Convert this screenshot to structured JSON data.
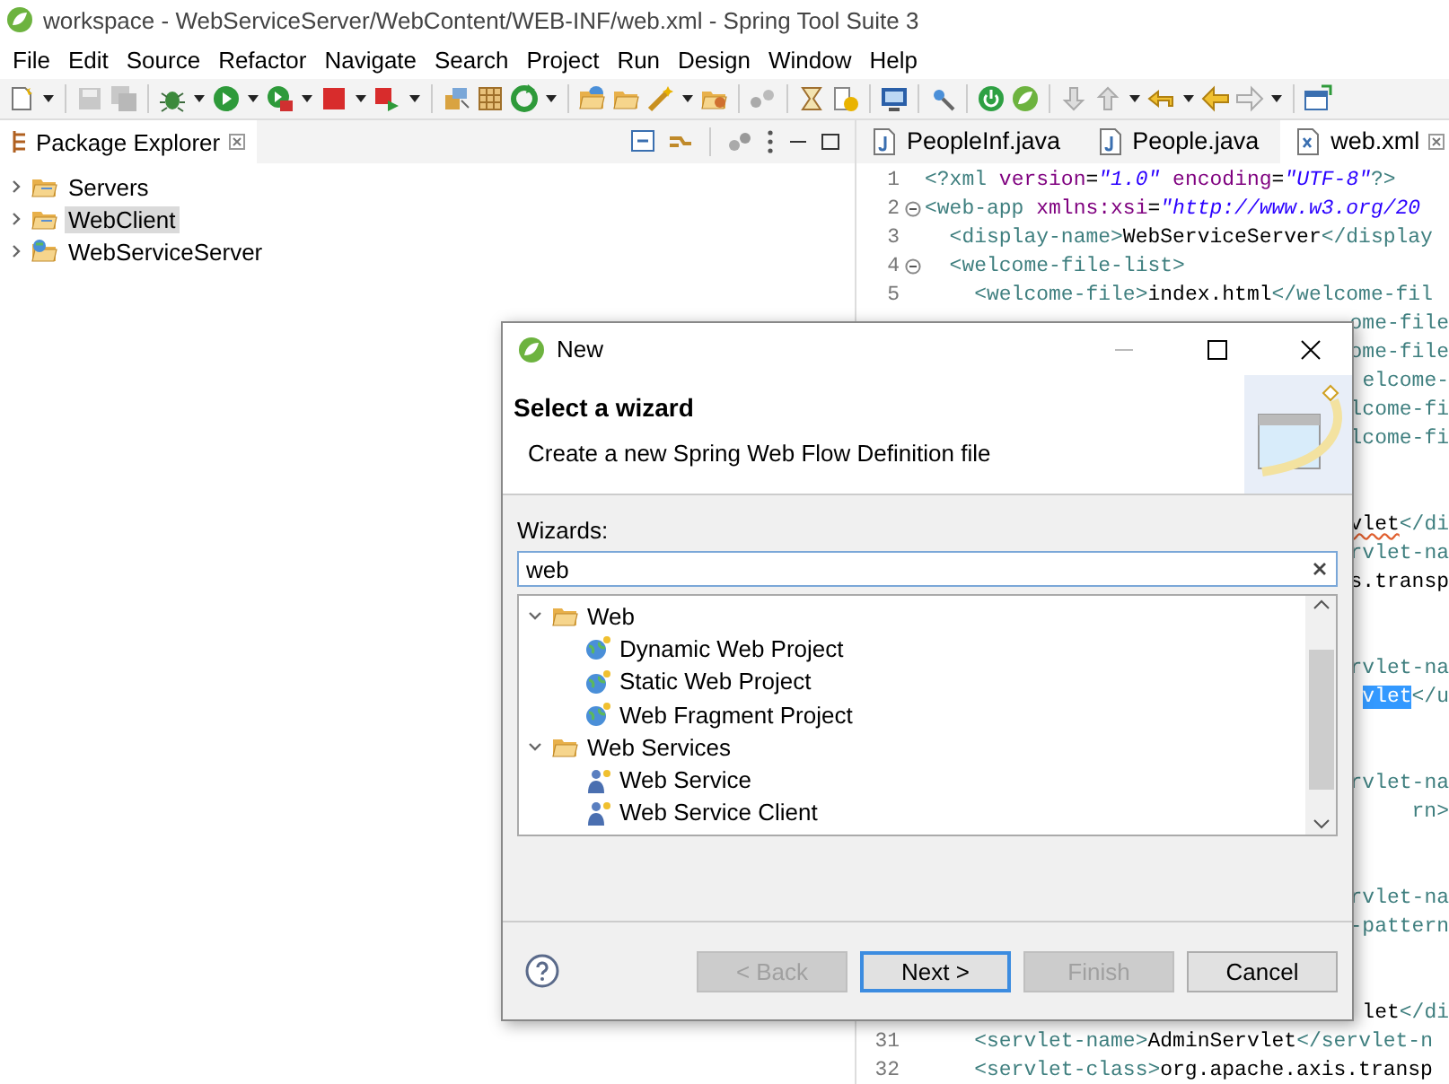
{
  "window": {
    "title": "workspace - WebServiceServer/WebContent/WEB-INF/web.xml - Spring Tool Suite 3"
  },
  "menu": [
    "File",
    "Edit",
    "Source",
    "Refactor",
    "Navigate",
    "Search",
    "Project",
    "Run",
    "Design",
    "Window",
    "Help"
  ],
  "package_explorer": {
    "title": "Package Explorer",
    "items": [
      {
        "label": "Servers",
        "kind": "folder",
        "expanded": false,
        "selected": false
      },
      {
        "label": "WebClient",
        "kind": "folder",
        "expanded": false,
        "selected": true
      },
      {
        "label": "WebServiceServer",
        "kind": "project",
        "expanded": false,
        "selected": false
      }
    ]
  },
  "editor": {
    "tabs": [
      {
        "label": "PeopleInf.java",
        "kind": "java",
        "selected": false
      },
      {
        "label": "People.java",
        "kind": "java",
        "selected": false
      },
      {
        "label": "web.xml",
        "kind": "xml",
        "selected": true
      }
    ],
    "lines": [
      {
        "number": "1",
        "fold": false,
        "behind_dialog": false,
        "segments": [
          {
            "kind": "tag",
            "text": "<?xml"
          },
          {
            "kind": "attr",
            "text": " version"
          },
          {
            "kind": "text",
            "text": "="
          },
          {
            "kind": "value",
            "text": "\"1.0\""
          },
          {
            "kind": "attr",
            "text": " encoding"
          },
          {
            "kind": "text",
            "text": "="
          },
          {
            "kind": "value",
            "text": "\"UTF-8\""
          },
          {
            "kind": "tag",
            "text": "?>"
          }
        ]
      },
      {
        "number": "2",
        "fold": true,
        "behind_dialog": false,
        "segments": [
          {
            "kind": "tag",
            "text": "<web-app"
          },
          {
            "kind": "attr",
            "text": " xmlns:xsi"
          },
          {
            "kind": "text",
            "text": "="
          },
          {
            "kind": "value",
            "text": "\"http://www.w3.org/20"
          }
        ]
      },
      {
        "number": "3",
        "fold": false,
        "behind_dialog": false,
        "segments": [
          {
            "kind": "tag",
            "text": "  <display-name>"
          },
          {
            "kind": "text",
            "text": "WebServiceServer"
          },
          {
            "kind": "tag",
            "text": "</display"
          }
        ]
      },
      {
        "number": "4",
        "fold": true,
        "behind_dialog": false,
        "segments": [
          {
            "kind": "tag",
            "text": "  <welcome-file-list>"
          }
        ]
      },
      {
        "number": "5",
        "fold": false,
        "behind_dialog": false,
        "segments": [
          {
            "kind": "tag",
            "text": "    <welcome-file>"
          },
          {
            "kind": "text",
            "text": "index.html"
          },
          {
            "kind": "tag",
            "text": "</welcome-fil"
          }
        ]
      },
      {
        "behind_dialog": true,
        "segments": [
          {
            "kind": "tag",
            "text": "ome-file"
          }
        ]
      },
      {
        "behind_dialog": true,
        "segments": [
          {
            "kind": "tag",
            "text": "ome-file"
          }
        ]
      },
      {
        "behind_dialog": true,
        "segments": [
          {
            "kind": "tag",
            "text": "elcome-"
          }
        ]
      },
      {
        "behind_dialog": true,
        "segments": [
          {
            "kind": "tag",
            "text": "lcome-fi"
          }
        ]
      },
      {
        "behind_dialog": true,
        "segments": [
          {
            "kind": "tag",
            "text": "lcome-fi"
          }
        ]
      },
      {
        "behind_dialog": true
      },
      {
        "behind_dialog": true
      },
      {
        "behind_dialog": true,
        "segments": [
          {
            "kind": "misspelled",
            "text": "vlet"
          },
          {
            "kind": "tag",
            "text": "</di"
          }
        ]
      },
      {
        "behind_dialog": true,
        "segments": [
          {
            "kind": "tag",
            "text": "rvlet-na"
          }
        ]
      },
      {
        "behind_dialog": true,
        "segments": [
          {
            "kind": "text",
            "text": "s.transp"
          }
        ]
      },
      {
        "behind_dialog": true
      },
      {
        "behind_dialog": true
      },
      {
        "behind_dialog": true,
        "segments": [
          {
            "kind": "tag",
            "text": "rvlet-na"
          }
        ]
      },
      {
        "behind_dialog": true,
        "segments": [
          {
            "kind": "selection",
            "text": "vlet"
          },
          {
            "kind": "tag",
            "text": "</u"
          }
        ]
      },
      {
        "behind_dialog": true
      },
      {
        "behind_dialog": true
      },
      {
        "behind_dialog": true,
        "segments": [
          {
            "kind": "tag",
            "text": "rvlet-na"
          }
        ]
      },
      {
        "behind_dialog": true,
        "segments": [
          {
            "kind": "tag",
            "text": "rn>"
          }
        ]
      },
      {
        "behind_dialog": true
      },
      {
        "behind_dialog": true
      },
      {
        "behind_dialog": true,
        "segments": [
          {
            "kind": "tag",
            "text": "rvlet-na"
          }
        ]
      },
      {
        "behind_dialog": true,
        "segments": [
          {
            "kind": "tag",
            "text": "-pattern"
          }
        ]
      },
      {
        "behind_dialog": true
      },
      {
        "behind_dialog": true
      },
      {
        "behind_dialog": true,
        "segments": [
          {
            "kind": "text",
            "text": "let"
          },
          {
            "kind": "tag",
            "text": "</di"
          }
        ]
      },
      {
        "number": "31",
        "fold": false,
        "behind_dialog": false,
        "segments": [
          {
            "kind": "tag",
            "text": "    <servlet-name>"
          },
          {
            "kind": "text",
            "text": "AdminServlet"
          },
          {
            "kind": "tag",
            "text": "</servlet-n"
          }
        ]
      },
      {
        "number": "32",
        "fold": false,
        "behind_dialog": false,
        "segments": [
          {
            "kind": "tag",
            "text": "    <servlet-class>"
          },
          {
            "kind": "text",
            "text": "org.apache.axis.transp"
          }
        ]
      }
    ]
  },
  "dialog": {
    "title": "New",
    "heading": "Select a wizard",
    "description": "Create a new Spring Web Flow Definition file",
    "filter_label": "Wizards:",
    "filter": {
      "value": "web"
    },
    "tree": [
      {
        "label": "Web",
        "expanded": true,
        "children": [
          {
            "label": "Dynamic Web Project",
            "kind": "project"
          },
          {
            "label": "Static Web Project",
            "kind": "project"
          },
          {
            "label": "Web Fragment Project",
            "kind": "project"
          }
        ]
      },
      {
        "label": "Web Services",
        "expanded": true,
        "children": [
          {
            "label": "Web Service",
            "kind": "service"
          },
          {
            "label": "Web Service Client",
            "kind": "service"
          }
        ]
      }
    ],
    "buttons": [
      {
        "label": "< Back",
        "disabled": true,
        "default": false
      },
      {
        "label": "Next >",
        "disabled": false,
        "default": true
      },
      {
        "label": "Finish",
        "disabled": true,
        "default": false
      },
      {
        "label": "Cancel",
        "disabled": false,
        "default": false
      }
    ]
  }
}
